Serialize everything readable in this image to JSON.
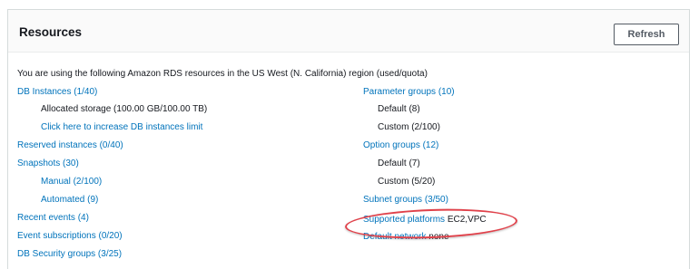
{
  "panel": {
    "title": "Resources",
    "refresh_label": "Refresh",
    "intro": "You are using the following Amazon RDS resources in the US West (N. California) region (used/quota)"
  },
  "left": {
    "db_instances": "DB Instances (1/40)",
    "allocated_storage": "Allocated storage (100.00 GB/100.00 TB)",
    "increase_limit": "Click here to increase DB instances limit",
    "reserved_instances": "Reserved instances (0/40)",
    "snapshots": "Snapshots (30)",
    "manual": "Manual (2/100)",
    "automated": "Automated (9)",
    "recent_events": "Recent events (4)",
    "event_subscriptions": "Event subscriptions (0/20)",
    "db_security_groups": "DB Security groups (3/25)"
  },
  "right": {
    "parameter_groups": "Parameter groups (10)",
    "pg_default": "Default (8)",
    "pg_custom": "Custom (2/100)",
    "option_groups": "Option groups (12)",
    "og_default": "Default (7)",
    "og_custom": "Custom (5/20)",
    "subnet_groups": "Subnet groups (3/50)",
    "supported_platforms_label": "Supported platforms",
    "supported_platforms_value": "EC2,VPC",
    "default_network_label": "Default network",
    "default_network_value": "none"
  },
  "colors": {
    "link": "#0073bb",
    "highlight": "#e0414a"
  }
}
